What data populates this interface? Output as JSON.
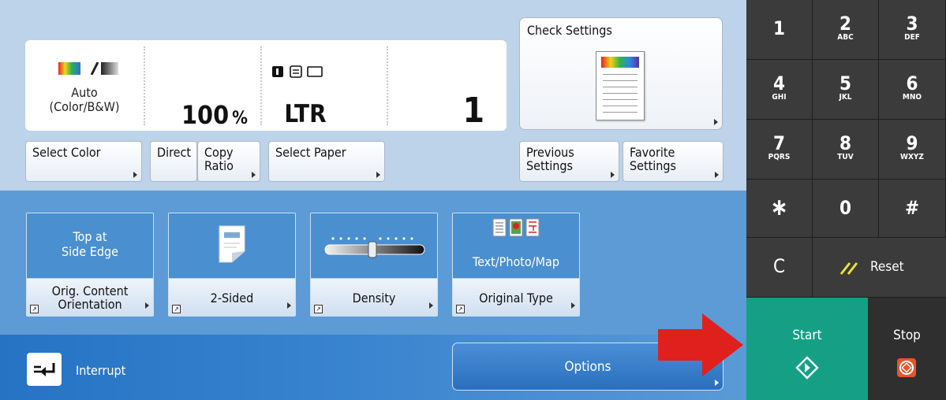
{
  "status": {
    "color_mode": "Auto\n(Color/B&W)",
    "copy_ratio_value": "100",
    "copy_ratio_unit": "%",
    "paper_size": "LTR",
    "copies": "1",
    "color_icon": "color-bw-icon",
    "paper_icons": "paper-type-icons"
  },
  "check_settings": {
    "label": "Check Settings",
    "icon": "document-preview-icon"
  },
  "buttons": {
    "select_color": "Select Color",
    "direct": "Direct",
    "copy_ratio": "Copy\nRatio",
    "select_paper": "Select Paper",
    "previous_settings": "Previous\nSettings",
    "favorite_settings": "Favorite\nSettings"
  },
  "tiles": [
    {
      "upper": "Top at\nSide Edge",
      "lower": "Orig. Content\nOrientation"
    },
    {
      "upper": "",
      "lower": "2-Sided",
      "icon": "two-sided-icon"
    },
    {
      "upper": "",
      "lower": "Density",
      "icon": "density-slider-icon"
    },
    {
      "upper": "Text/Photo/Map",
      "lower": "Original Type",
      "icon": "original-type-icons"
    }
  ],
  "interrupt": {
    "label": "Interrupt",
    "icon": "interrupt-icon"
  },
  "options": {
    "label": "Options"
  },
  "keypad": {
    "keys": [
      {
        "num": "1",
        "sub": ""
      },
      {
        "num": "2",
        "sub": "ABC"
      },
      {
        "num": "3",
        "sub": "DEF"
      },
      {
        "num": "4",
        "sub": "GHI"
      },
      {
        "num": "5",
        "sub": "JKL"
      },
      {
        "num": "6",
        "sub": "MNO"
      },
      {
        "num": "7",
        "sub": "PQRS"
      },
      {
        "num": "8",
        "sub": "TUV"
      },
      {
        "num": "9",
        "sub": "WXYZ"
      },
      {
        "num": "∗",
        "sub": ""
      },
      {
        "num": "0",
        "sub": ""
      },
      {
        "num": "#",
        "sub": ""
      },
      {
        "num": "C",
        "sub": ""
      }
    ],
    "reset": "Reset",
    "start": "Start",
    "stop": "Stop"
  },
  "colors": {
    "start": "#15a085",
    "stop_icon": "#e8542b",
    "arrow": "#e0201c",
    "reset_icon": "#e8e23a"
  }
}
